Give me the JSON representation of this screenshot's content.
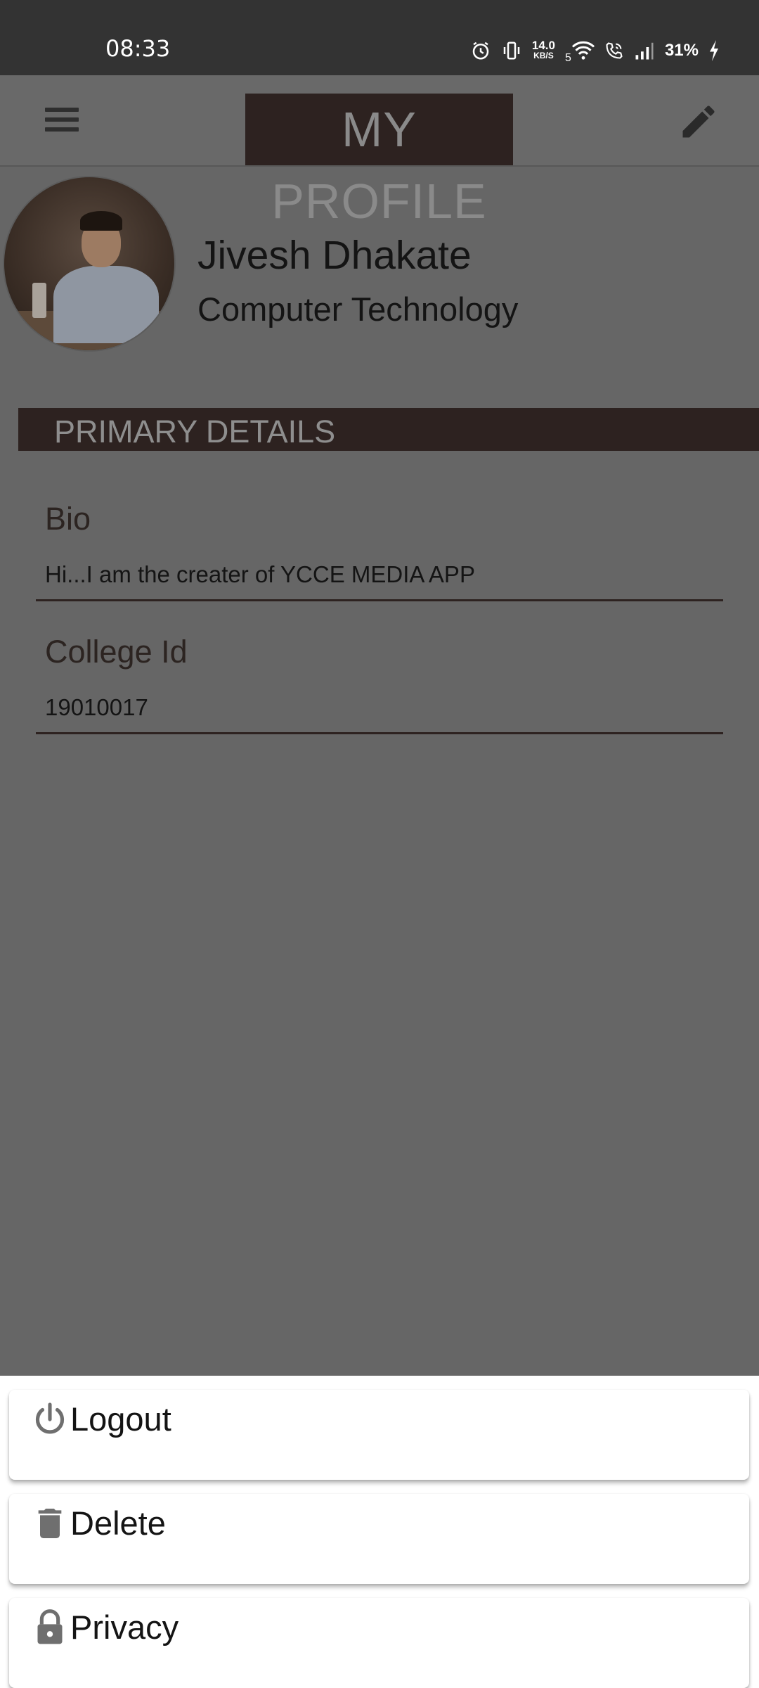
{
  "status_bar": {
    "time": "08:33",
    "net_speed_value": "14.0",
    "net_speed_unit": "KB/S",
    "network_label": "5",
    "battery": "31%"
  },
  "app_bar": {
    "title": "MY PROFILE",
    "menu_icon": "hamburger-menu-icon",
    "edit_icon": "pencil-edit-icon"
  },
  "profile": {
    "name": "Jivesh Dhakate",
    "department": "Computer Technology"
  },
  "primary_details": {
    "header": "PRIMARY DETAILS",
    "fields": [
      {
        "label": "Bio",
        "value": "Hi...I am the creater of YCCE MEDIA APP"
      },
      {
        "label": "College Id",
        "value": "19010017"
      }
    ]
  },
  "bottom_sheet": {
    "items": [
      {
        "label": "Logout",
        "icon": "power-icon"
      },
      {
        "label": "Delete",
        "icon": "trash-icon"
      },
      {
        "label": "Privacy",
        "icon": "lock-icon"
      }
    ]
  },
  "colors": {
    "overlay": "#666666",
    "status_bar": "#333333",
    "accent_dark": "#2d2220",
    "sheet_bg": "#ffffff"
  }
}
